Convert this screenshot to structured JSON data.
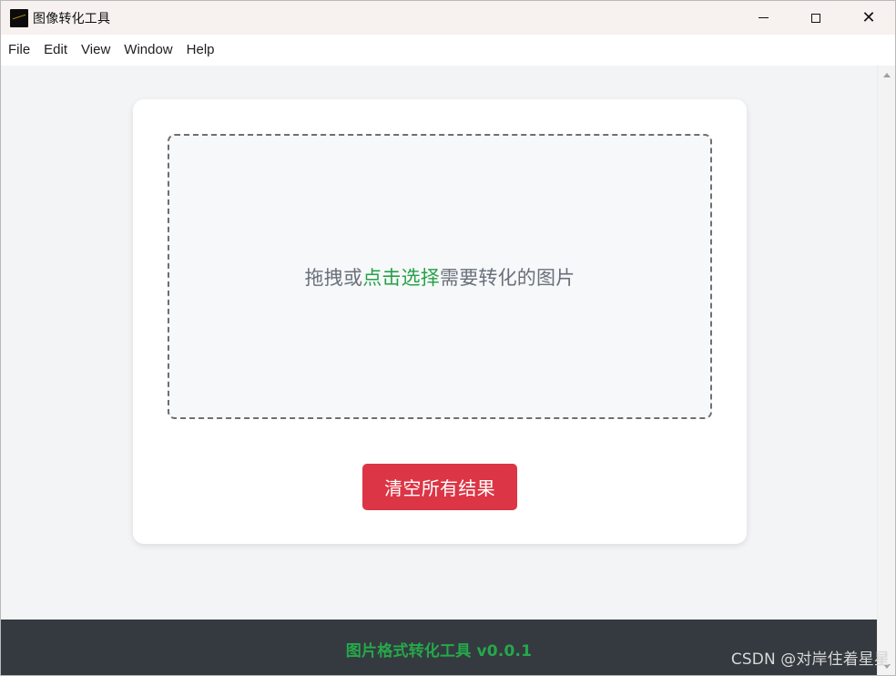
{
  "window": {
    "title": "图像转化工具",
    "controls": {
      "minimize": "minimize",
      "maximize": "maximize",
      "close": "✕"
    }
  },
  "menu": [
    {
      "label": "File"
    },
    {
      "label": "Edit"
    },
    {
      "label": "View"
    },
    {
      "label": "Window"
    },
    {
      "label": "Help"
    }
  ],
  "dropzone": {
    "before": "拖拽或",
    "link": "点击选择",
    "after": "需要转化的图片"
  },
  "actions": {
    "clear_all": "清空所有结果"
  },
  "footer": {
    "text": "图片格式转化工具 v0.0.1"
  },
  "watermark": {
    "text": "CSDN @对岸住着星星"
  },
  "colors": {
    "accent_green": "#24a148",
    "danger_red": "#dc3545",
    "footer_bg": "#343a40",
    "surface": "#ffffff",
    "background": "#f3f4f6"
  }
}
